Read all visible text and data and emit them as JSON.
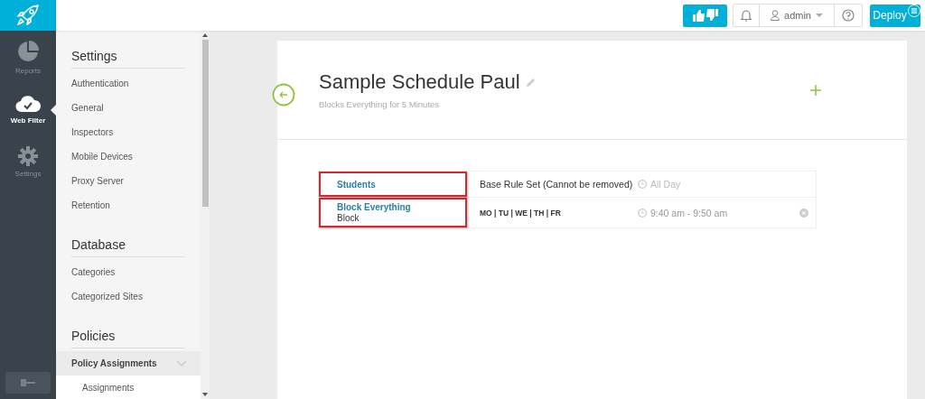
{
  "rail": [
    {
      "label": "Reports",
      "kind": "pie",
      "selected": false
    },
    {
      "label": "Web Filter",
      "kind": "cloud",
      "selected": true
    },
    {
      "label": "Settings",
      "kind": "gear",
      "selected": false
    }
  ],
  "topbar": {
    "user": "admin",
    "deploy": "Deploy"
  },
  "sidebar": {
    "sections": [
      {
        "title": "Settings",
        "items": [
          {
            "label": "Authentication"
          },
          {
            "label": "General"
          },
          {
            "label": "Inspectors"
          },
          {
            "label": "Mobile Devices"
          },
          {
            "label": "Proxy Server"
          },
          {
            "label": "Retention"
          }
        ]
      },
      {
        "title": "Database",
        "items": [
          {
            "label": "Categories"
          },
          {
            "label": "Categorized Sites"
          }
        ]
      },
      {
        "title": "Policies",
        "items": [
          {
            "label": "Policy Assignments",
            "expanded": true,
            "children": [
              {
                "label": "Assignments"
              }
            ]
          }
        ]
      }
    ]
  },
  "schedule": {
    "title": "Sample Schedule Paul",
    "subtitle": "Blocks Everything for 5 Minutes",
    "rules": [
      {
        "name": "Students",
        "kind": "base",
        "detail": "Base Rule Set (Cannot be removed)",
        "time": "All Day",
        "highlighted": true,
        "removable": false
      },
      {
        "name": "Block Everything",
        "action": "Block",
        "kind": "days",
        "detail": "MO | TU | WE | TH | FR",
        "time": "9:40 am - 9:50 am",
        "highlighted": true,
        "removable": true
      }
    ]
  }
}
